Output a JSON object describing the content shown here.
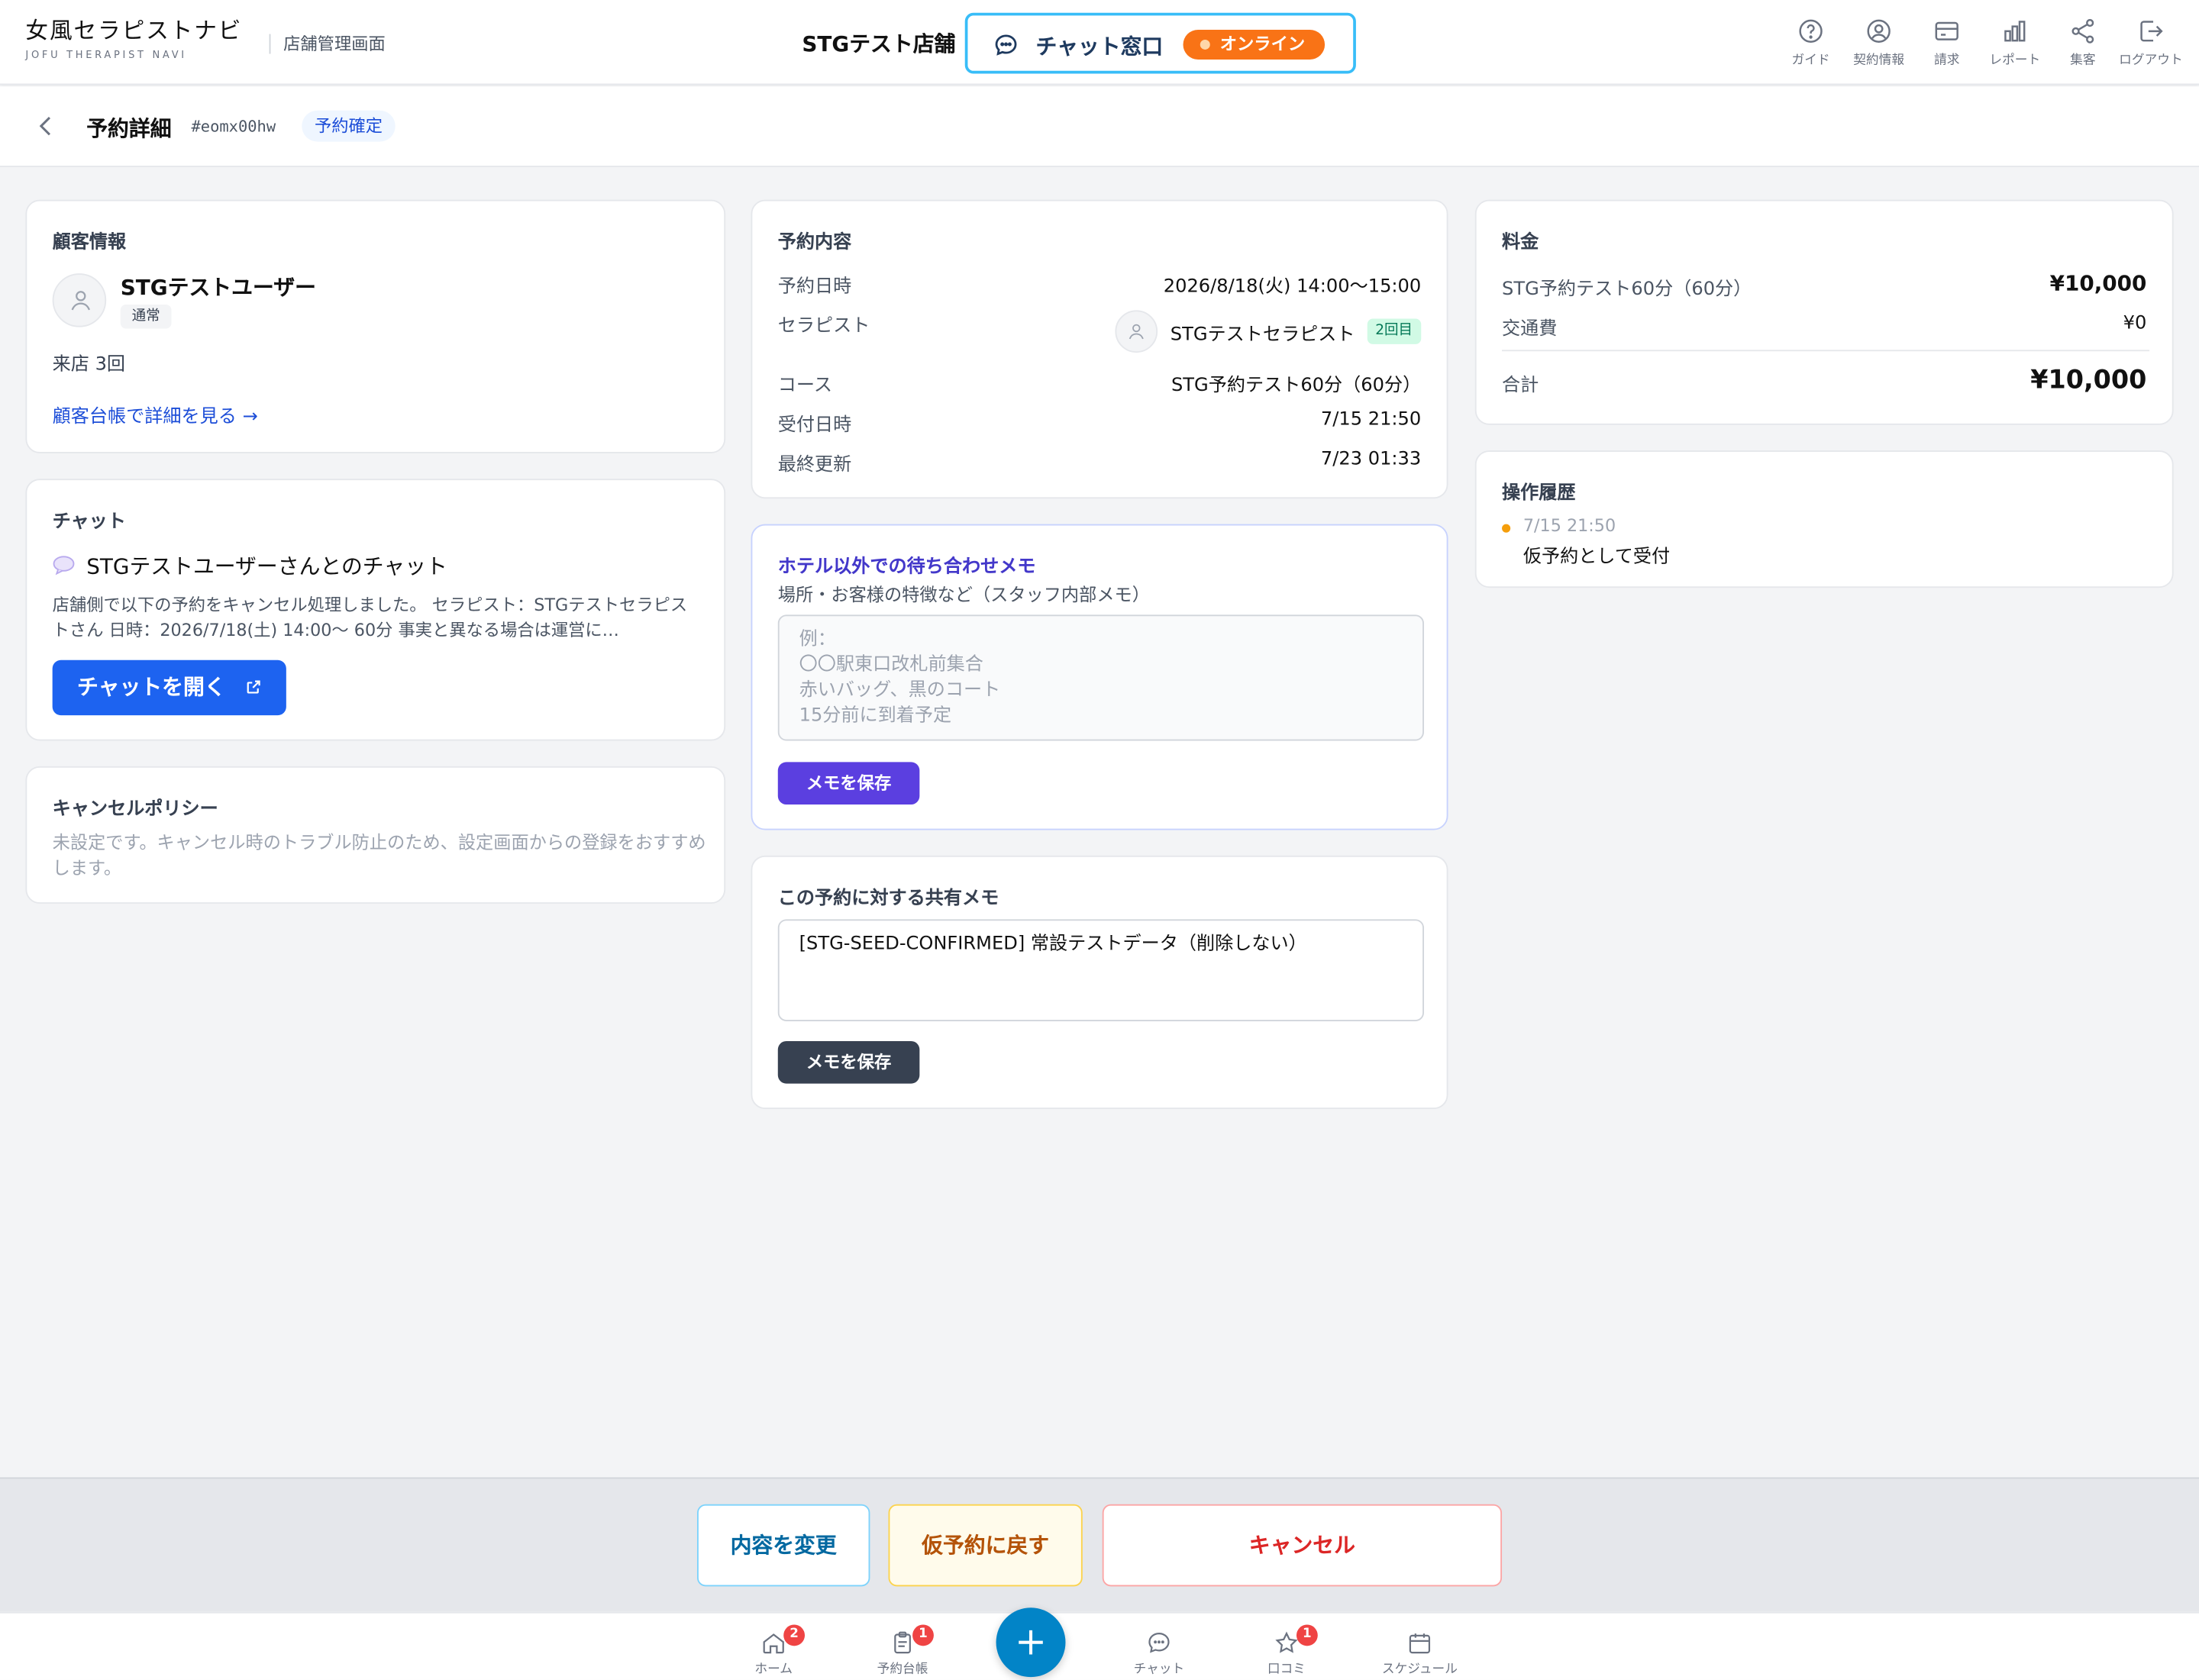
{
  "header": {
    "logo_main": "女風セラピストナビ",
    "logo_sub": "JOFU THERAPIST NAVI",
    "admin_label": "店舗管理画面",
    "store_name": "STGテスト店舗",
    "chat_window_label": "チャット窓口",
    "online_label": "オンライン",
    "nav": [
      {
        "label": "ガイド",
        "icon": "help-circle-icon"
      },
      {
        "label": "契約情報",
        "icon": "user-circle-icon"
      },
      {
        "label": "請求",
        "icon": "credit-card-icon"
      },
      {
        "label": "レポート",
        "icon": "bar-chart-icon"
      },
      {
        "label": "集客",
        "icon": "share-icon"
      },
      {
        "label": "ログアウト",
        "icon": "logout-icon"
      }
    ]
  },
  "subheader": {
    "title": "予約詳細",
    "booking_id": "#eomx00hw",
    "status": "予約確定"
  },
  "customer": {
    "title": "顧客情報",
    "name": "STGテストユーザー",
    "tag": "通常",
    "visits": "来店 3回",
    "ledger_link": "顧客台帳で詳細を見る →"
  },
  "chat": {
    "title": "チャット",
    "heading": "STGテストユーザーさんとのチャット",
    "preview": "店舗側で以下の予約をキャンセル処理しました。 セラピスト：STGテストセラピストさん 日時：2026/7/18(土) 14:00〜 60分 事実と異なる場合は運営に…",
    "open_button": "チャットを開く"
  },
  "cancel_policy": {
    "title": "キャンセルポリシー",
    "body": "未設定です。キャンセル時のトラブル防止のため、設定画面からの登録をおすすめします。"
  },
  "booking": {
    "title": "予約内容",
    "rows": [
      {
        "label": "予約日時",
        "value": "2026/8/18(火) 14:00〜15:00"
      },
      {
        "label": "セラピスト",
        "value": "STGテストセラピスト"
      },
      {
        "label": "コース",
        "value": "STG予約テスト60分（60分）"
      },
      {
        "label": "受付日時",
        "value": "7/15 21:50"
      },
      {
        "label": "最終更新",
        "value": "7/23 01:33"
      }
    ],
    "therapist_badge": "2回目"
  },
  "meeting_memo": {
    "title": "ホテル以外での待ち合わせメモ",
    "subtitle": "場所・お客様の特徴など（スタッフ内部メモ）",
    "placeholder": "例：\n〇〇駅東口改札前集合\n赤いバッグ、黒のコート\n15分前に到着予定",
    "save_button": "メモを保存"
  },
  "shared_memo": {
    "title": "この予約に対する共有メモ",
    "value": "[STG-SEED-CONFIRMED] 常設テストデータ（削除しない）",
    "save_button": "メモを保存"
  },
  "fee": {
    "title": "料金",
    "rows": [
      {
        "label": "STG予約テスト60分（60分）",
        "value": "¥10,000"
      },
      {
        "label": "交通費",
        "value": "¥0"
      }
    ],
    "total_label": "合計",
    "total_value": "¥10,000"
  },
  "history": {
    "title": "操作履歴",
    "items": [
      {
        "time": "7/15 21:50",
        "text": "仮予約として受付"
      }
    ]
  },
  "actions": {
    "change": "内容を変更",
    "revert": "仮予約に戻す",
    "cancel": "キャンセル"
  },
  "bottom_nav": [
    {
      "label": "ホーム",
      "badge": "2",
      "icon": "home-icon"
    },
    {
      "label": "予約台帳",
      "badge": "1",
      "icon": "clipboard-icon"
    },
    {
      "label": "チャット",
      "badge": "",
      "icon": "chat-icon"
    },
    {
      "label": "口コミ",
      "badge": "1",
      "icon": "star-icon"
    },
    {
      "label": "スケジュール",
      "badge": "",
      "icon": "calendar-icon"
    }
  ],
  "colors": {
    "accent_blue": "#1d4ed8",
    "chat_button": "#1d63f0",
    "memo_purple": "#5b3fe0",
    "online_orange": "#f97316",
    "fab": "#0284c7",
    "cancel_red": "#dc2626"
  }
}
